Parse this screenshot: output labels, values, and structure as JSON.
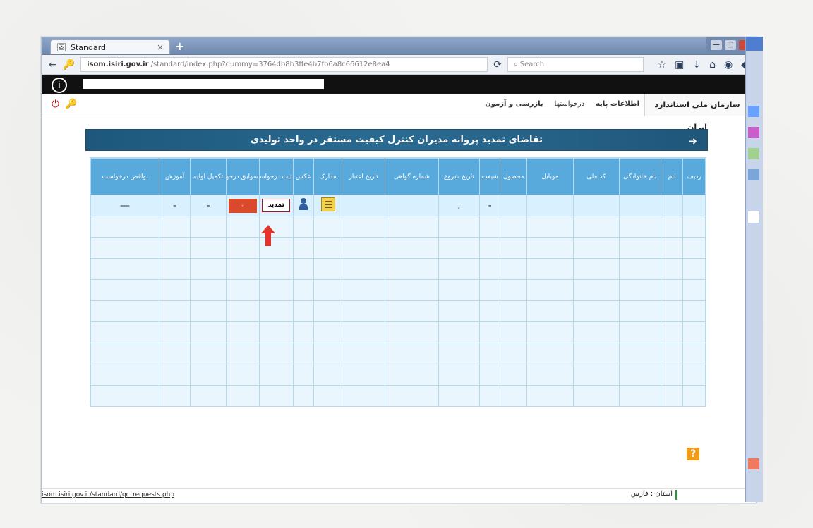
{
  "browser": {
    "tab_title": "Standard",
    "tab_close": "×",
    "new_tab": "+",
    "url_domain": "isom.isiri.gov.ir",
    "url_path": "/standard/index.php?dummy=3764db8b3ffe4b7fb6a8c66612e8ea4",
    "search_placeholder": "Search"
  },
  "page": {
    "org_name": "سازمان ملی استاندارد ایران",
    "menu": [
      "اطلاعات پایه",
      "درخواستها",
      "بازرسی و آزمون"
    ],
    "banner_title": "تقاضای تمدید پروانه مدیران کنترل کیفیت مستقر در واحد تولیدی",
    "table": {
      "headers": [
        "ردیف",
        "نام",
        "نام خانوادگی",
        "کد ملی",
        "موبایل",
        "محصول",
        "شیفت",
        "تاریخ شروع",
        "شماره گواهی",
        "تاریخ اعتبار",
        "مدارک",
        "عکس",
        "ثبت درخواست",
        "سوابق درخواست",
        "تکمیل اولیه",
        "آموزش",
        "نواقص درخواست"
      ],
      "row": {
        "shift": "-",
        "start_date": ".",
        "submit_label": "تمدید",
        "history": "-",
        "initial": "-",
        "training": "-",
        "defects": "—"
      }
    },
    "status_url": "isom.isiri.gov.ir/standard/qc_requests.php",
    "status_province_label": "استان :",
    "status_province_value": "فارس",
    "help": "?"
  }
}
